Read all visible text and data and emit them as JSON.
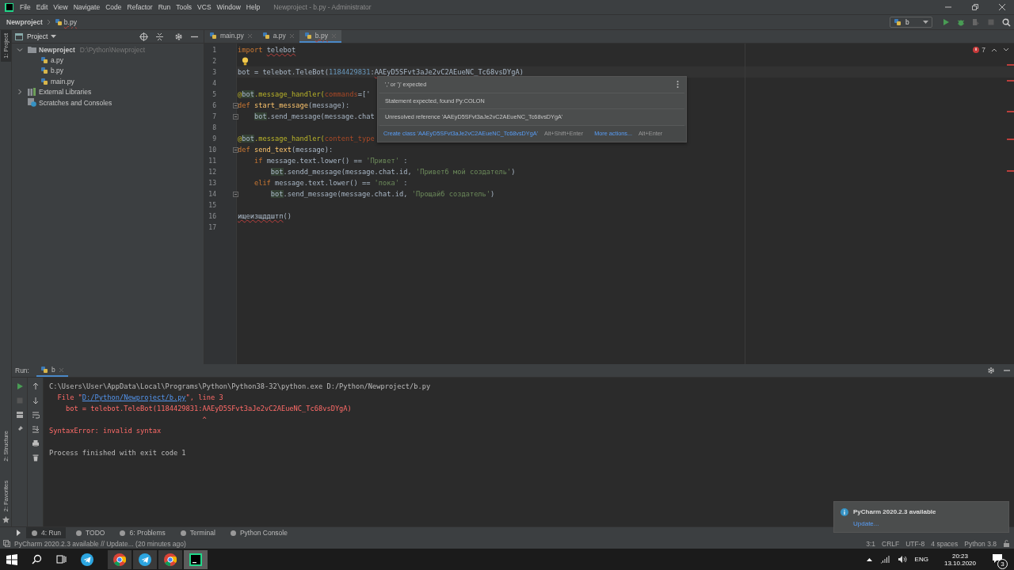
{
  "menu_bar": {
    "items": [
      "File",
      "Edit",
      "View",
      "Navigate",
      "Code",
      "Refactor",
      "Run",
      "Tools",
      "VCS",
      "Window",
      "Help"
    ],
    "title": "Newproject - b.py - Administrator"
  },
  "nav_bar": {
    "breadcrumbs": [
      "Newproject",
      "b.py"
    ],
    "run_config": "b"
  },
  "side_tabs": {
    "top": "1: Project",
    "middle": "2: Structure",
    "bottom": "2: Favorites"
  },
  "project_panel": {
    "title": "Project",
    "tree": [
      {
        "label": "Newproject",
        "path": "D:\\Python\\Newproject",
        "kind": "folder",
        "expanded": true,
        "children": [
          {
            "label": "a.py",
            "kind": "py"
          },
          {
            "label": "b.py",
            "kind": "py"
          },
          {
            "label": "main.py",
            "kind": "py"
          }
        ]
      },
      {
        "label": "External Libraries",
        "kind": "lib",
        "expanded": false
      },
      {
        "label": "Scratches and Consoles",
        "kind": "scratch"
      }
    ]
  },
  "editor": {
    "tabs": [
      {
        "label": "main.py",
        "selected": false
      },
      {
        "label": "a.py",
        "selected": false
      },
      {
        "label": "b.py",
        "selected": true
      }
    ],
    "error_count": "7",
    "lines": [
      {
        "number": "1",
        "current": false,
        "fold": false,
        "tokens": [
          {
            "t": "import ",
            "kind": "kw"
          },
          {
            "t": "telebot",
            "kind": "err"
          }
        ]
      },
      {
        "number": "2",
        "current": false,
        "fold": false,
        "tokens": [
          {
            "kind": "bulb"
          }
        ]
      },
      {
        "number": "3",
        "current": true,
        "fold": false,
        "tokens": [
          {
            "t": "bot = telebot.TeleBot(",
            "kind": "plain"
          },
          {
            "t": "1184429831",
            "kind": "num"
          },
          {
            "t": ":",
            "kind": "plain"
          },
          {
            "t": "AAEyD5SFvt3aJe2vC2AEueNC_Tc68vsDYgA",
            "kind": "err"
          },
          {
            "t": ")",
            "kind": "plain"
          }
        ]
      },
      {
        "number": "4",
        "current": false,
        "fold": false
      },
      {
        "number": "5",
        "current": false,
        "fold": false,
        "tokens": [
          {
            "t": "@",
            "kind": "deco"
          },
          {
            "t": "bot",
            "kind": "hl"
          },
          {
            "t": ".message_handler(",
            "kind": "deco"
          },
          {
            "t": "commands",
            "kind": "param"
          },
          {
            "t": "=['",
            "kind": "plain"
          }
        ]
      },
      {
        "number": "6",
        "current": false,
        "fold": true,
        "tokens": [
          {
            "t": "def ",
            "kind": "kw"
          },
          {
            "t": "start_message",
            "kind": "fn"
          },
          {
            "t": "(message):",
            "kind": "plain"
          }
        ]
      },
      {
        "number": "7",
        "current": false,
        "fold": true,
        "tokens": [
          {
            "t": "    bot",
            "kind": "hl"
          },
          {
            "t": ".send_message(message.chat",
            "kind": "plain"
          }
        ]
      },
      {
        "number": "8",
        "current": false,
        "fold": false
      },
      {
        "number": "9",
        "current": false,
        "fold": false,
        "tokens": [
          {
            "t": "@",
            "kind": "deco"
          },
          {
            "t": "bot",
            "kind": "hl"
          },
          {
            "t": ".message_handler(",
            "kind": "deco"
          },
          {
            "t": "content_type",
            "kind": "param"
          }
        ]
      },
      {
        "number": "10",
        "current": false,
        "fold": true,
        "tokens": [
          {
            "t": "def ",
            "kind": "kw"
          },
          {
            "t": "send_text",
            "kind": "fn"
          },
          {
            "t": "(message):",
            "kind": "plain"
          }
        ]
      },
      {
        "number": "11",
        "current": false,
        "fold": false,
        "tokens": [
          {
            "t": "    if",
            "kind": "kw"
          },
          {
            "t": " message.text.lower() == ",
            "kind": "plain"
          },
          {
            "t": "'Привет'",
            "kind": "str"
          },
          {
            "t": " :",
            "kind": "plain"
          }
        ]
      },
      {
        "number": "12",
        "current": false,
        "fold": false,
        "tokens": [
          {
            "t": "        bot",
            "kind": "hl"
          },
          {
            "t": ".sendd_message(message.chat.id, ",
            "kind": "plain"
          },
          {
            "t": "'Приветб мой создатель'",
            "kind": "str"
          },
          {
            "t": ")",
            "kind": "plain"
          }
        ]
      },
      {
        "number": "13",
        "current": false,
        "fold": false,
        "tokens": [
          {
            "t": "    elif",
            "kind": "kw"
          },
          {
            "t": " message.text.lower() == ",
            "kind": "plain"
          },
          {
            "t": "'пока'",
            "kind": "str"
          },
          {
            "t": " :",
            "kind": "plain"
          }
        ]
      },
      {
        "number": "14",
        "current": false,
        "fold": true,
        "tokens": [
          {
            "t": "        bot",
            "kind": "hl"
          },
          {
            "t": ".send_message(message.chat.id, ",
            "kind": "plain"
          },
          {
            "t": "'Прощайб создатель'",
            "kind": "str"
          },
          {
            "t": ")",
            "kind": "plain"
          }
        ]
      },
      {
        "number": "15",
        "current": false,
        "fold": false
      },
      {
        "number": "16",
        "current": false,
        "fold": false,
        "tokens": [
          {
            "t": "ищеизщддштп",
            "kind": "err"
          },
          {
            "t": "()",
            "kind": "plain"
          }
        ]
      },
      {
        "number": "17",
        "current": false,
        "fold": false
      }
    ]
  },
  "popup": {
    "messages": [
      "',' or ')' expected",
      "Statement expected, found Py:COLON",
      "Unresolved reference 'AAEyD5SFvt3aJe2vC2AEueNC_Tc68vsDYgA'"
    ],
    "actions": [
      {
        "label": "Create class 'AAEyD5SFvt3aJe2vC2AEueNC_Tc68vsDYgA'",
        "shortcut": "Alt+Shift+Enter"
      },
      {
        "label": "More actions...",
        "shortcut": "Alt+Enter"
      }
    ]
  },
  "run_panel": {
    "label": "Run:",
    "tab": "b",
    "output": [
      {
        "kind": "plain",
        "text": "C:\\Users\\User\\AppData\\Local\\Programs\\Python\\Python38-32\\python.exe D:/Python/Newproject/b.py"
      },
      {
        "kind": "link",
        "pre": "  File \"",
        "link": "D:/Python/Newproject/b.py",
        "post": "\", line 3"
      },
      {
        "kind": "error",
        "text": "    bot = telebot.TeleBot(1184429831:AAEyD5SFvt3aJe2vC2AEueNC_Tc68vsDYgA)"
      },
      {
        "kind": "error",
        "text": "                                     ^"
      },
      {
        "kind": "error",
        "text": "SyntaxError: invalid syntax"
      },
      {
        "kind": "blank"
      },
      {
        "kind": "plain",
        "text": "Process finished with exit code 1"
      }
    ]
  },
  "bottom_tabs": [
    {
      "label": "4: Run",
      "selected": true
    },
    {
      "label": "TODO",
      "selected": false
    },
    {
      "label": "6: Problems",
      "selected": false
    },
    {
      "label": "Terminal",
      "selected": false
    },
    {
      "label": "Python Console",
      "selected": false
    }
  ],
  "status_bar": {
    "message": "PyCharm 2020.2.3 available // Update... (20 minutes ago)",
    "items": [
      "3:1",
      "CRLF",
      "UTF-8",
      "4 spaces",
      "Python 3.8"
    ]
  },
  "notification": {
    "title": "PyCharm 2020.2.3 available",
    "link": "Update..."
  },
  "taskbar": {
    "lang": "ENG",
    "time": "20:23",
    "date": "13.10.2020",
    "notifications": "3"
  }
}
